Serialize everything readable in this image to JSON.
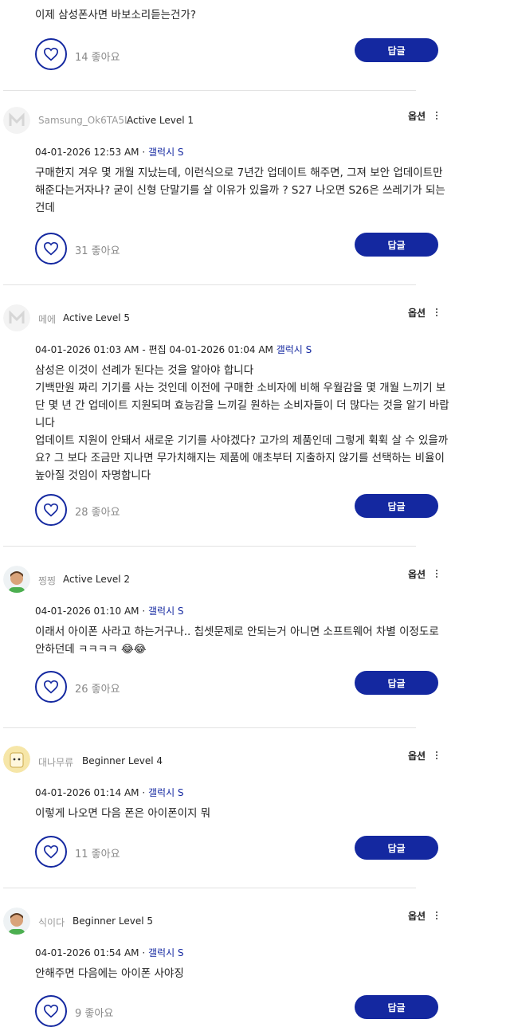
{
  "comment_prev": {
    "text": "이제 삼성폰사면 바보소리듣는건가?",
    "likes": "14 좋아요"
  },
  "ui": {
    "reply_label": "답글",
    "options_label": "옵션"
  },
  "comments": [
    {
      "username": "Samsung_Ok6TA5L",
      "level": "Active Level 1",
      "timestamp": "04-01-2026 12:53 AM",
      "category": "갤럭시 S",
      "body": [
        "구매한지 겨우 몇 개월 지났는데, 이런식으로 7년간 업데이트 해주면, 그져 보안 업데이트만 해준다는거자나? 굳이 신형 단말기를 살 이유가 있을까 ? S27 나오면 S26은 쓰레기가 되는건데"
      ],
      "likes": "31 좋아요"
    },
    {
      "username": "메에",
      "level": "Active Level 5",
      "timestamp": "04-01-2026 01:03 AM - 편집 04-01-2026 01:04 AM",
      "category": "갤럭시 S",
      "body": [
        "삼성은 이것이 선례가 된다는 것을 알아야 합니다",
        "기백만원 짜리 기기를 사는 것인데 이전에 구매한 소비자에 비해 우월감을 몇 개월 느끼기 보단 몇 년 간 업데이트 지원되며 효능감을 느끼길 원하는 소비자들이 더 많다는 것을 알기 바랍니다",
        "업데이트 지원이 안돼서 새로운 기기를 사야겠다? 고가의 제품인데 그렇게 휙휙 살 수 있을까요? 그 보다 조금만 지나면 무가치해지는 제품에 애초부터 지출하지 않기를 선택하는 비율이 높아질 것임이 자명합니다"
      ],
      "likes": "28 좋아요"
    },
    {
      "username": "찡찡",
      "level": "Active Level 2",
      "timestamp": "04-01-2026 01:10 AM",
      "category": "갤럭시 S",
      "body": [
        "이래서 아이폰 사라고 하는거구나.. 칩셋문제로 안되는거 아니면 소프트웨어 차별 이정도로 안하던데 ㅋㅋㅋㅋ 😂😂"
      ],
      "likes": "26 좋아요"
    },
    {
      "username": "대나무류",
      "level": "Beginner Level 4",
      "timestamp": "04-01-2026 01:14 AM",
      "category": "갤럭시 S",
      "body": [
        "이렇게 나오면 다음 폰은 아이폰이지 뭐"
      ],
      "likes": "11 좋아요"
    },
    {
      "username": "식이다",
      "level": "Beginner Level 5",
      "timestamp": "04-01-2026 01:54 AM",
      "category": "갤럭시 S",
      "body": [
        "안해주면 다음에는 아이폰 사야징"
      ],
      "likes": "9 좋아요"
    }
  ],
  "icons": {
    "like": "heart-icon",
    "more": "vertical-dots-icon",
    "avatar_default": "m-logo-avatar",
    "avatar_person": "person-avatar",
    "avatar_cartoon": "cartoon-avatar"
  },
  "colors": {
    "accent": "#1428a0",
    "muted": "#999999",
    "divider": "#e2e2e2"
  }
}
